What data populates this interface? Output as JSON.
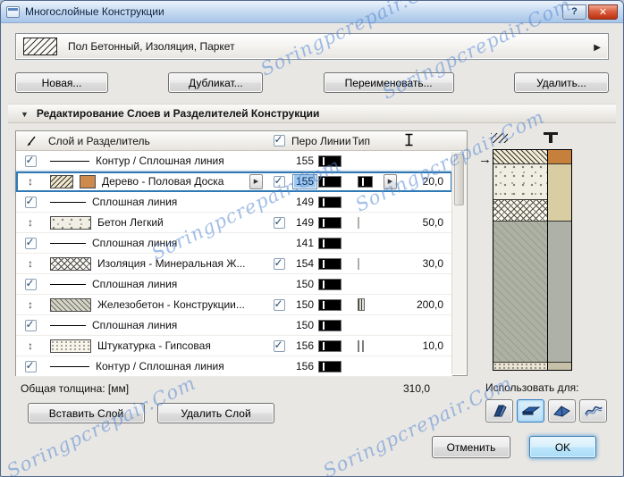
{
  "window": {
    "title": "Многослойные Конструкции",
    "help": "?",
    "close": "✕"
  },
  "watermark": {
    "text": "Soringpcrepair.Com"
  },
  "composite": {
    "name": "Пол Бетонный, Изоляция, Паркет"
  },
  "actions": {
    "new": "Новая...",
    "duplicate": "Дубликат...",
    "rename": "Переименовать...",
    "delete": "Удалить..."
  },
  "section": {
    "title": "Редактирование Слоев и Разделителей Конструкции"
  },
  "table": {
    "headers": {
      "layer": "Слой и Разделитель",
      "pen": "Перо Линии",
      "type": "Тип"
    },
    "rows": [
      {
        "kind": "separator",
        "name": "Контур / Сплошная линия",
        "pen": "155",
        "thickness": ""
      },
      {
        "kind": "layer",
        "selected": true,
        "name": "Дерево - Половая Доска",
        "pen": "155",
        "thickness": "20,0"
      },
      {
        "kind": "separator",
        "name": "Сплошная линия",
        "pen": "149",
        "thickness": ""
      },
      {
        "kind": "layer",
        "name": "Бетон Легкий",
        "pen": "149",
        "thickness": "50,0"
      },
      {
        "kind": "separator",
        "name": "Сплошная линия",
        "pen": "141",
        "thickness": ""
      },
      {
        "kind": "layer",
        "name": "Изоляция - Минеральная Ж...",
        "pen": "154",
        "thickness": "30,0"
      },
      {
        "kind": "separator",
        "name": "Сплошная линия",
        "pen": "150",
        "thickness": ""
      },
      {
        "kind": "layer",
        "name": "Железобетон - Конструкции...",
        "pen": "150",
        "thickness": "200,0"
      },
      {
        "kind": "separator",
        "name": "Сплошная линия",
        "pen": "150",
        "thickness": ""
      },
      {
        "kind": "layer",
        "name": "Штукатурка - Гипсовая",
        "pen": "156",
        "thickness": "10,0"
      },
      {
        "kind": "separator",
        "name": "Контур / Сплошная линия",
        "pen": "156",
        "thickness": ""
      }
    ],
    "total_label": "Общая толщина: [мм]",
    "total_value": "310,0"
  },
  "layer_buttons": {
    "insert": "Вставить Слой",
    "remove": "Удалить Слой"
  },
  "use_for": {
    "label": "Использовать для:"
  },
  "footer": {
    "cancel": "Отменить",
    "ok": "OK"
  }
}
